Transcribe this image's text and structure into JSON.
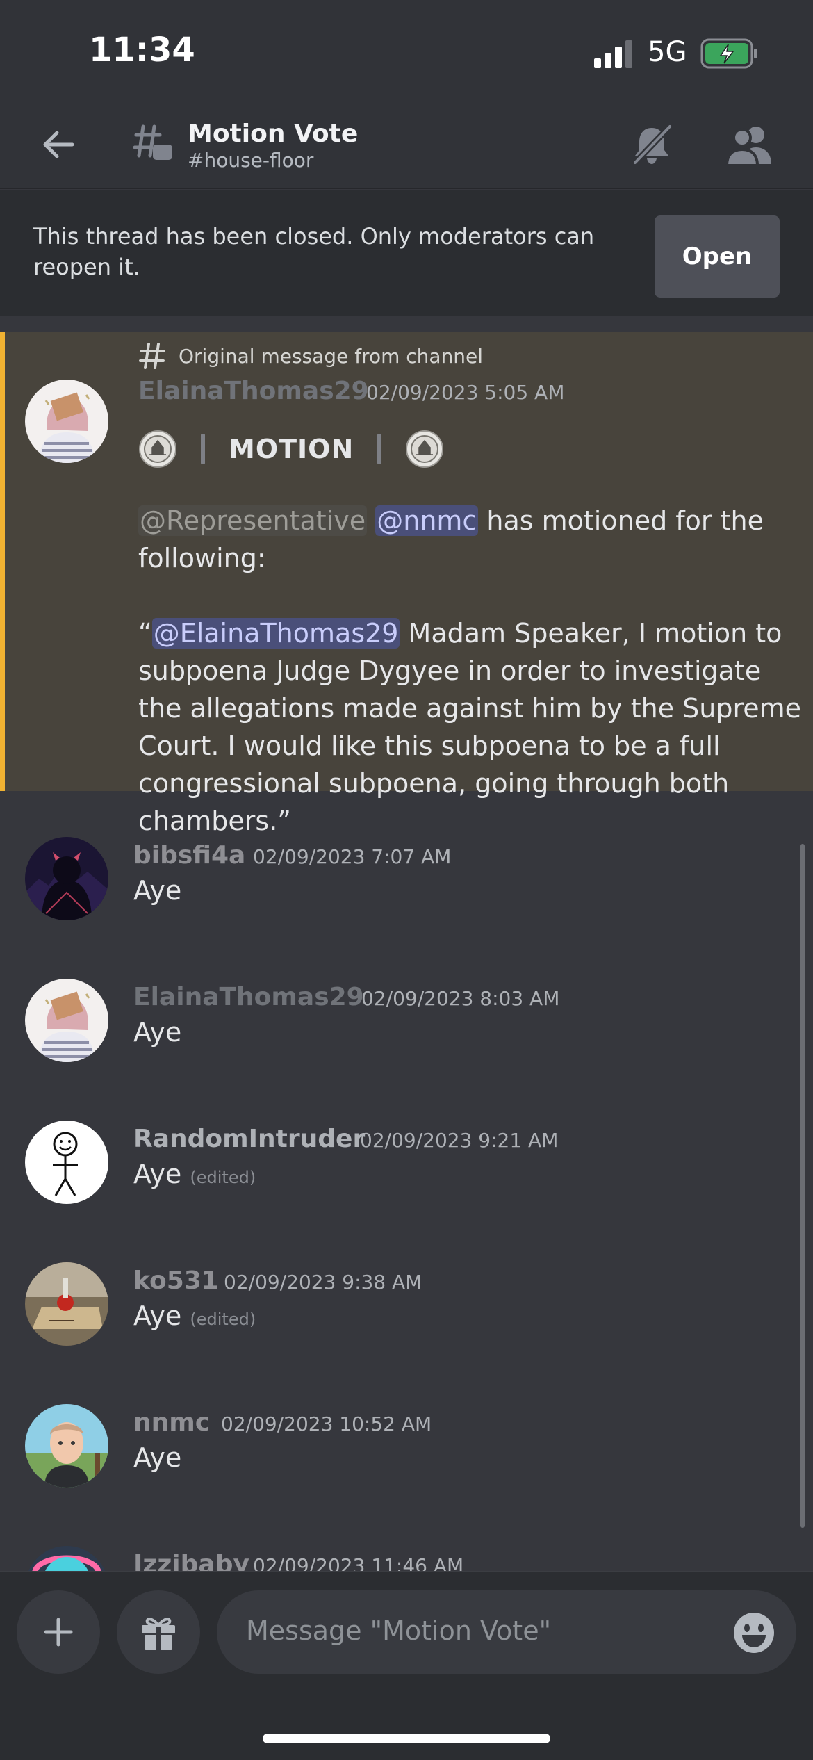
{
  "status_bar": {
    "time": "11:34",
    "network": "5G"
  },
  "header": {
    "title": "Motion Vote",
    "channel": "#house-floor"
  },
  "banner": {
    "text": "This thread has been closed. Only moderators can reopen it.",
    "button": "Open"
  },
  "starter": {
    "origin_label": "Original message from channel",
    "author": "ElainaThomas29",
    "timestamp": "02/09/2023 5:05 AM",
    "motion_word": "MOTION",
    "mention_role": "@Representative",
    "mention_user": "@nnmc",
    "line1_rest": " has motioned for the following:",
    "quote_open": "“",
    "quote_mention": "@ElainaThomas29",
    "quote_text": " Madam Speaker, I motion to subpoena Judge Dygyee in order to investigate the allegations made against him by the Supreme Court. I would like this subpoena to be a full congressional subpoena, going through both chambers.”"
  },
  "messages": [
    {
      "author": "bibsfi4a",
      "timestamp": "02/09/2023 7:07 AM",
      "text": "Aye",
      "edited": ""
    },
    {
      "author": "ElainaThomas29",
      "timestamp": "02/09/2023 8:03 AM",
      "text": "Aye",
      "edited": ""
    },
    {
      "author": "RandomIntruder",
      "timestamp": "02/09/2023 9:21 AM",
      "text": "Aye",
      "edited": "(edited)"
    },
    {
      "author": "ko531",
      "timestamp": "02/09/2023 9:38 AM",
      "text": "Aye",
      "edited": "(edited)"
    },
    {
      "author": "nnmc",
      "timestamp": "02/09/2023 10:52 AM",
      "text": "Aye",
      "edited": ""
    },
    {
      "author": "Izzibaby",
      "timestamp": "02/09/2023 11:46 AM",
      "text": "",
      "edited": ""
    }
  ],
  "composer": {
    "placeholder": "Message \"Motion Vote\""
  },
  "colors": {
    "accent": "#f0b232",
    "mention_bg": "#4a4f79",
    "button_bg": "#4e5058",
    "battery": "#3ba55c"
  },
  "icons": [
    "back-arrow-icon",
    "thread-icon",
    "muted-bell-icon",
    "members-icon",
    "hash-icon",
    "seal-icon",
    "plus-icon",
    "gift-icon",
    "emoji-icon"
  ]
}
